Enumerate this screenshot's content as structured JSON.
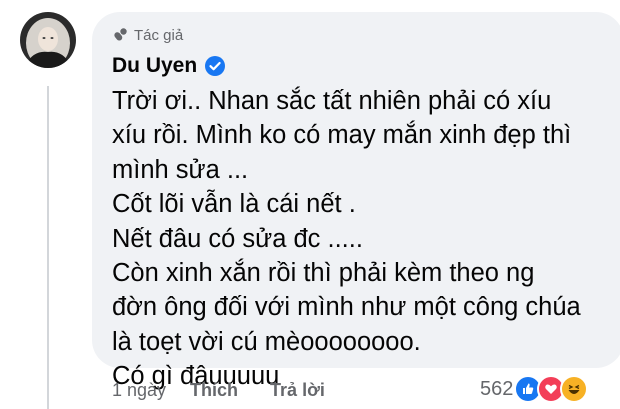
{
  "comment": {
    "badge": "Tác giả",
    "author": "Du Uyen",
    "lines": [
      "Trời ơi.. Nhan sắc tất nhiên phải có xíu",
      "xíu rồi. Mình ko có may mắn xinh đẹp thì",
      "mình sửa ...",
      "Cốt lõi vẫn là cái nết .",
      "Nết đâu có sửa đc .....",
      "Còn xinh xắn rồi thì phải kèm theo ng",
      "đờn ông đối với mình như một công chúa",
      "là toẹt vời cú mèoooooooo.",
      "Có gì đâuuuuu"
    ]
  },
  "actions": {
    "timestamp": "1 ngày",
    "like": "Thích",
    "reply": "Trả lời"
  },
  "reactions": {
    "count": "562",
    "icons": [
      "like-icon",
      "love-icon",
      "haha-icon"
    ]
  },
  "colors": {
    "bubble": "#f0f2f5",
    "verified": "#1877f2",
    "like": "#1877f2",
    "love": "#f33e58",
    "haha": "#f7b125",
    "muted_text": "#65676b"
  }
}
